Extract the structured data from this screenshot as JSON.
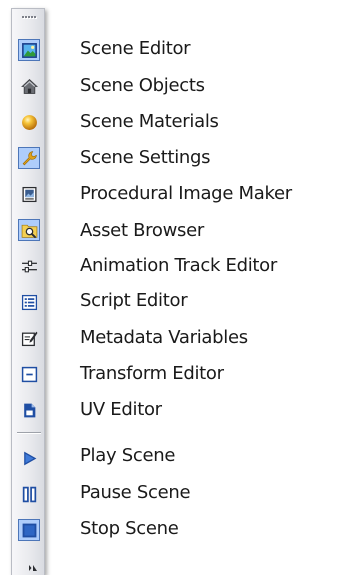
{
  "toolbar": {
    "tools": [
      {
        "id": "scene-editor",
        "label": "Scene Editor",
        "icon": "landscape-icon",
        "pressed": true
      },
      {
        "id": "scene-objects",
        "label": "Scene Objects",
        "icon": "house-icon",
        "pressed": false
      },
      {
        "id": "scene-materials",
        "label": "Scene Materials",
        "icon": "sphere-icon",
        "pressed": false
      },
      {
        "id": "scene-settings",
        "label": "Scene Settings",
        "icon": "wrench-icon",
        "pressed": true
      },
      {
        "id": "procedural-image-maker",
        "label": "Procedural Image Maker",
        "icon": "image-frame-icon",
        "pressed": false
      },
      {
        "id": "asset-browser",
        "label": "Asset Browser",
        "icon": "magnifier-icon",
        "pressed": true
      },
      {
        "id": "animation-track-editor",
        "label": "Animation Track Editor",
        "icon": "track-icon",
        "pressed": false
      },
      {
        "id": "script-editor",
        "label": "Script Editor",
        "icon": "script-list-icon",
        "pressed": false
      },
      {
        "id": "metadata-variables",
        "label": "Metadata Variables",
        "icon": "edit-note-icon",
        "pressed": false
      },
      {
        "id": "transform-editor",
        "label": "Transform Editor",
        "icon": "transform-box-icon",
        "pressed": false
      },
      {
        "id": "uv-editor",
        "label": "UV Editor",
        "icon": "document-icon",
        "pressed": false
      }
    ],
    "playback": [
      {
        "id": "play-scene",
        "label": "Play Scene",
        "icon": "play-icon",
        "pressed": false
      },
      {
        "id": "pause-scene",
        "label": "Pause Scene",
        "icon": "pause-icon",
        "pressed": false
      },
      {
        "id": "stop-scene",
        "label": "Stop Scene",
        "icon": "stop-icon",
        "pressed": true
      }
    ],
    "colors": {
      "pressed_fill": "#aecdfb",
      "pressed_border": "#4d76b8",
      "icon_blue": "#1f4ea3",
      "label_text": "#1a1a1a"
    }
  }
}
